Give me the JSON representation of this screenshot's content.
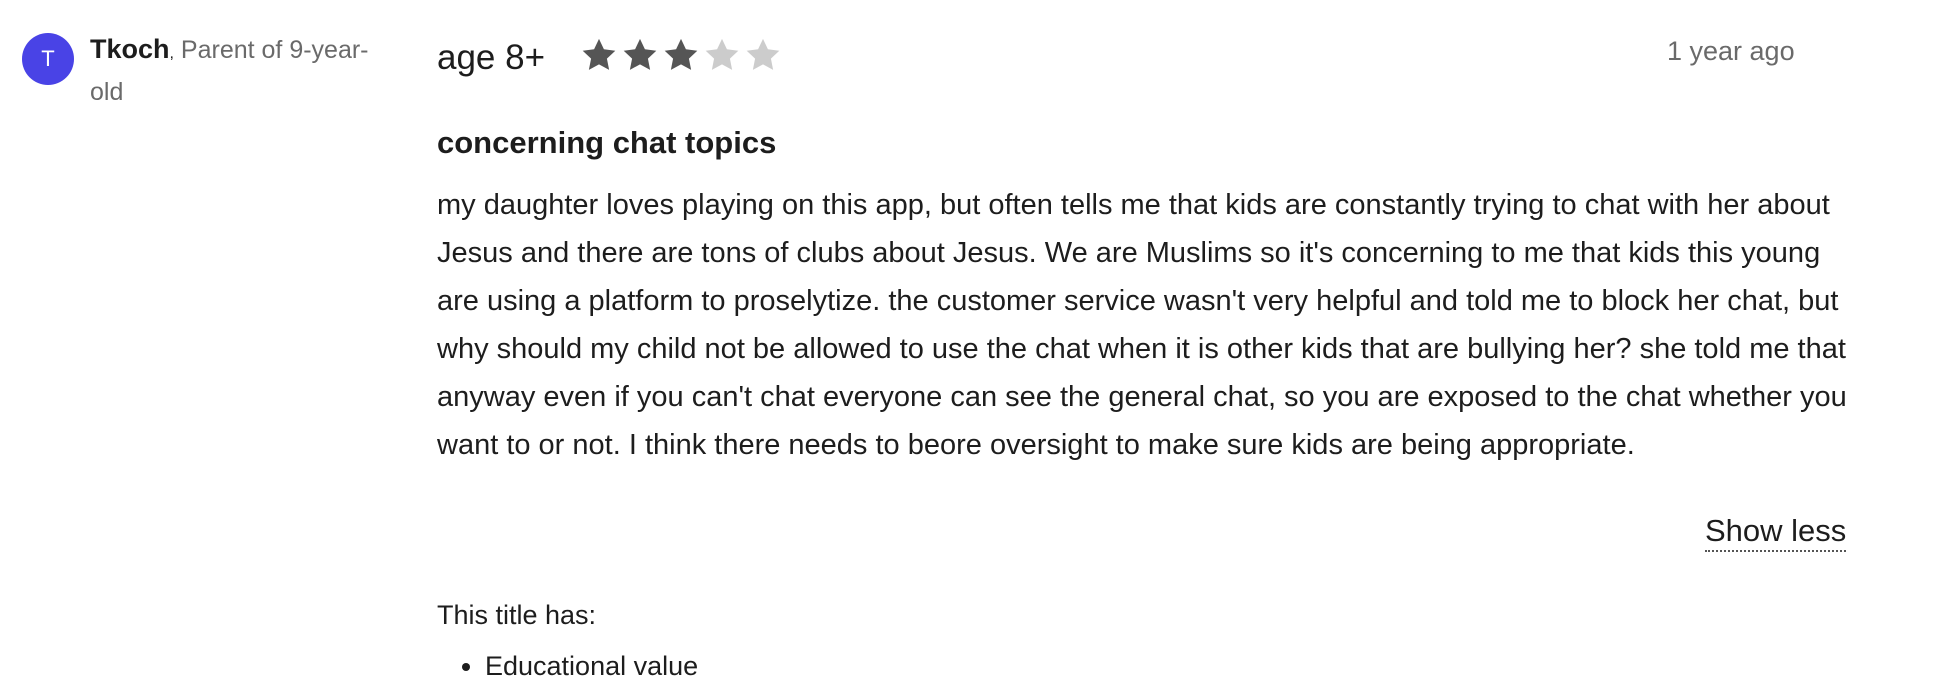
{
  "review": {
    "author": {
      "initial": "T",
      "name": "Tkoch",
      "separator": ",",
      "role": " Parent of 9-year-old"
    },
    "age": "age 8+",
    "rating": {
      "value": 3,
      "max": 5,
      "filled_color": "#555555",
      "empty_color": "#cccccc"
    },
    "date": "1 year ago",
    "title": "concerning chat topics",
    "body": "my daughter loves playing on this app, but often tells me that kids are constantly trying to chat with her about Jesus and there are tons of clubs about Jesus. We are Muslims so it's concerning to me that kids this young are using a platform to proselytize. the customer service wasn't very helpful and told me to block her chat, but why should my child not be allowed to use the chat when it is other kids that are bullying her? she told me that anyway even if you can't chat everyone can see the general chat, so you are exposed to the chat whether you want to or not. I think there needs to beore oversight to make sure kids are being appropriate.",
    "show_less_label": "Show less",
    "has_label": "This title has:",
    "has_items": [
      "Educational value"
    ]
  },
  "colors": {
    "avatar_bg": "#4943e6"
  }
}
